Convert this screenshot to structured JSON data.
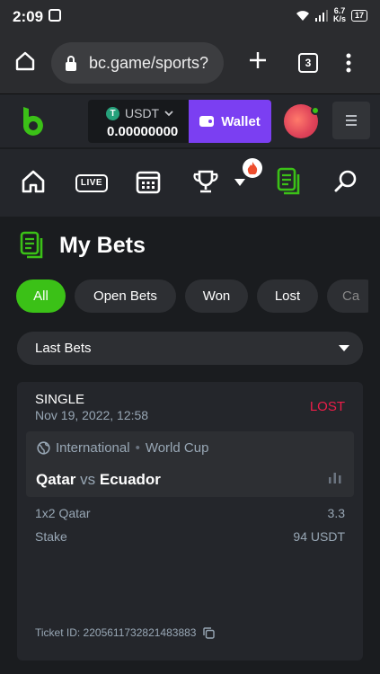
{
  "status_bar": {
    "time": "2:09",
    "net_speed_top": "6.7",
    "net_speed_bottom": "K/s",
    "battery": "17"
  },
  "browser": {
    "url": "bc.game/sports?",
    "tab_count": "3"
  },
  "header": {
    "currency": "USDT",
    "balance": "0.00000000",
    "wallet_label": "Wallet"
  },
  "nav": {
    "live_label": "LIVE"
  },
  "page": {
    "title": "My Bets"
  },
  "filters": [
    "All",
    "Open Bets",
    "Won",
    "Lost",
    "Ca"
  ],
  "select": {
    "value": "Last Bets"
  },
  "bet": {
    "type": "SINGLE",
    "date": "Nov 19, 2022, 12:58",
    "status": "LOST",
    "league_region": "International",
    "league_separator": "•",
    "league_name": "World Cup",
    "home_team": "Qatar",
    "vs": "vs",
    "away_team": "Ecuador",
    "market": "1x2 Qatar",
    "odds": "3.3",
    "stake_label": "Stake",
    "stake_value": "94 USDT",
    "ticket_id": "Ticket ID: 2205611732821483883"
  },
  "colors": {
    "accent_green": "#3bc117",
    "wallet_purple": "#7b3ff2",
    "lost_red": "#ed1d49"
  }
}
